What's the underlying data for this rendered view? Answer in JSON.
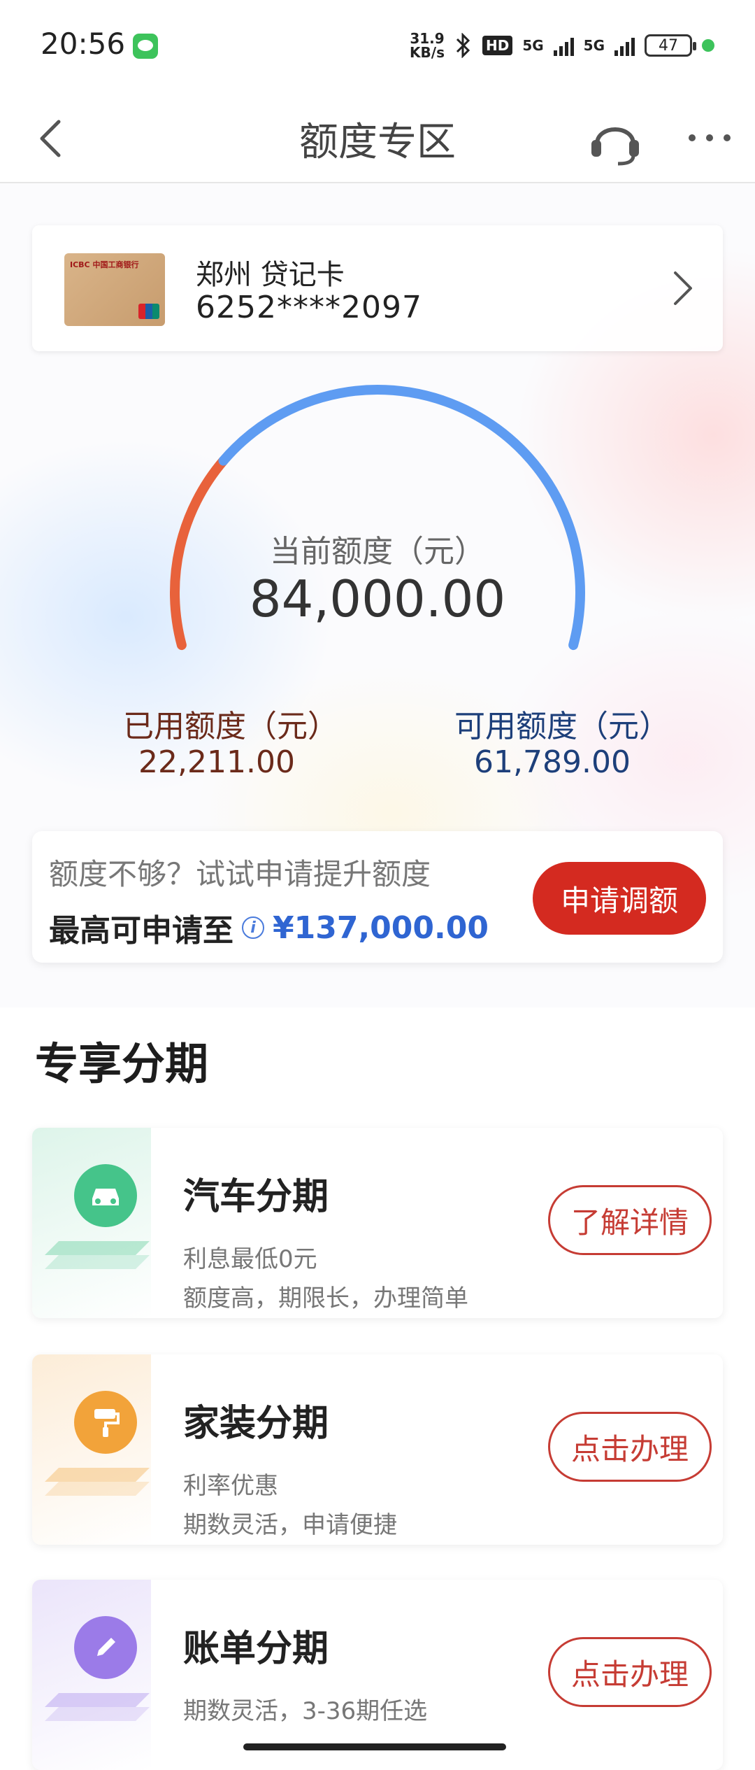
{
  "status_bar": {
    "time": "20:56",
    "speed_top": "31.9",
    "speed_bottom": "KB/s",
    "hd_label": "HD",
    "net1": "5G",
    "net2": "5G",
    "battery": "47",
    "icons": [
      "wechat-icon",
      "bluetooth-icon",
      "signal-icon",
      "battery-icon"
    ]
  },
  "nav": {
    "title": "额度专区",
    "icons": [
      "back-icon",
      "headset-icon",
      "more-icon"
    ]
  },
  "card": {
    "name": "郑州 贷记卡",
    "number": "6252****2097",
    "thumb_logo": "ICBC 中国工商银行"
  },
  "gauge": {
    "label": "当前额度（元）",
    "value": "84,000.00",
    "used_fraction": 0.2644,
    "used_color": "#e8623b",
    "available_color": "#5e9cf2"
  },
  "used": {
    "label": "已用额度（元）",
    "value": "22,211.00"
  },
  "available": {
    "label": "可用额度（元）",
    "value": "61,789.00"
  },
  "promo": {
    "hint": "额度不够？试试申请提升额度",
    "max_label": "最高可申请至",
    "info_icon": "i",
    "amount": "¥137,000.00",
    "button": "申请调额"
  },
  "section": {
    "title": "专享分期"
  },
  "installments": [
    {
      "title": "汽车分期",
      "line1": "利息最低0元",
      "line2": "额度高，期限长，办理简单",
      "button": "了解详情",
      "icon": "car-icon",
      "color": "#45c48a"
    },
    {
      "title": "家装分期",
      "line1": "利率优惠",
      "line2": "期数灵活，申请便捷",
      "button": "点击办理",
      "icon": "paint-roller-icon",
      "color": "#f2a33a"
    },
    {
      "title": "账单分期",
      "line1": "期数灵活，3-36期任选",
      "line2": "",
      "button": "点击办理",
      "icon": "pen-icon",
      "color": "#9b7be8"
    }
  ]
}
